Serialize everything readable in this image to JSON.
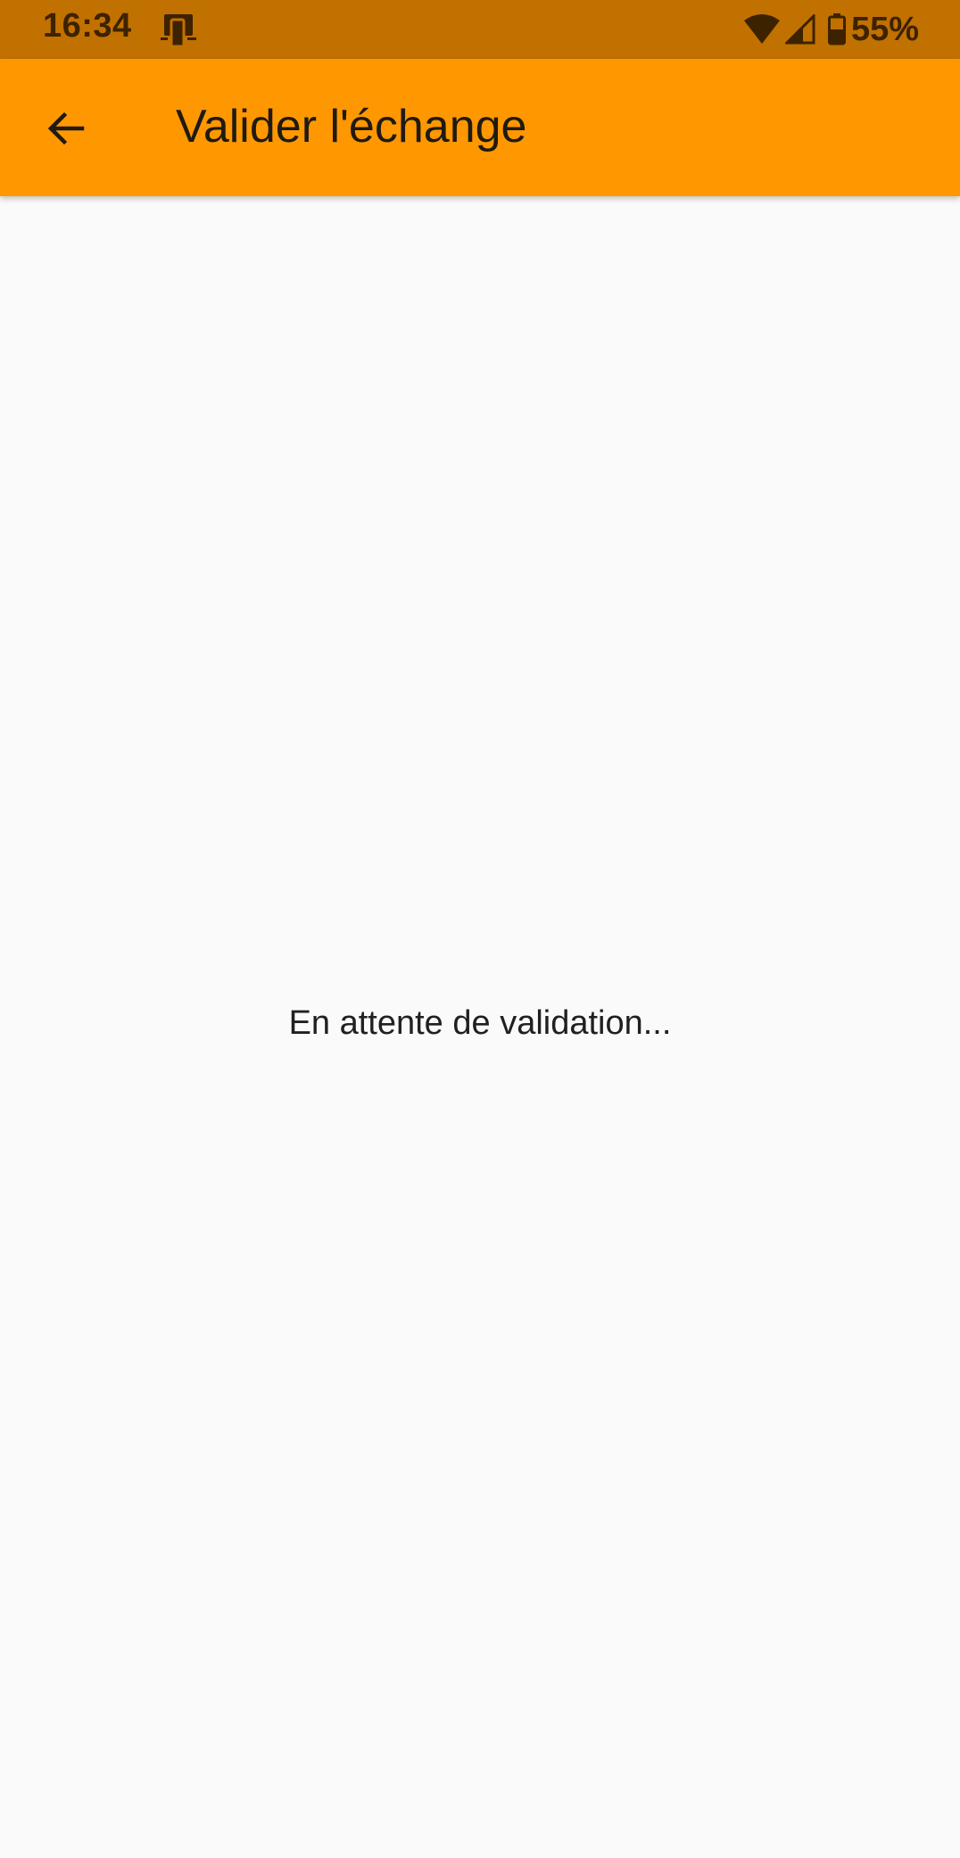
{
  "status_bar": {
    "time": "16:34",
    "battery_percent": "55%",
    "notification_icon": "cast-device-icon",
    "icons": [
      "wifi-icon",
      "signal-icon",
      "battery-icon"
    ]
  },
  "app_bar": {
    "title": "Valider l'échange",
    "back_icon": "arrow-back-icon"
  },
  "content": {
    "message": "En attente de validation..."
  },
  "colors": {
    "status_bar": "#c17100",
    "app_bar": "#ff9800",
    "background": "#fafafa"
  }
}
